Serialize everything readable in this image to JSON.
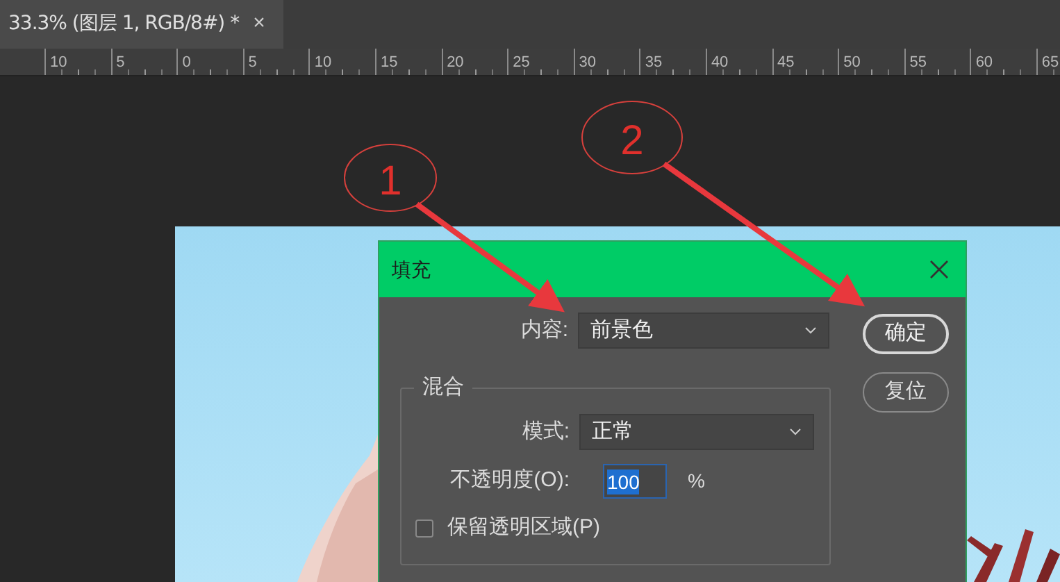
{
  "document_tab": {
    "title": "33.3% (图层 1, RGB/8#) *",
    "close": "×"
  },
  "ruler": {
    "labels": [
      "10",
      "5",
      "0",
      "5",
      "10",
      "15",
      "20",
      "25",
      "30",
      "35",
      "40",
      "45",
      "50",
      "55",
      "60",
      "65"
    ]
  },
  "dialog": {
    "title": "填充",
    "content_label": "内容:",
    "content_value": "前景色",
    "buttons": [
      {
        "label": "确定",
        "default": true
      },
      {
        "label": "复位",
        "default": false
      }
    ],
    "blend": {
      "legend": "混合",
      "mode_label": "模式:",
      "mode_value": "正常",
      "opacity_label": "不透明度(O):",
      "opacity_value": "100",
      "opacity_unit": "%",
      "preserve": {
        "label": "保留透明区域(P)",
        "checked": false
      }
    }
  },
  "annotations": [
    {
      "number": "1"
    },
    {
      "number": "2"
    }
  ]
}
